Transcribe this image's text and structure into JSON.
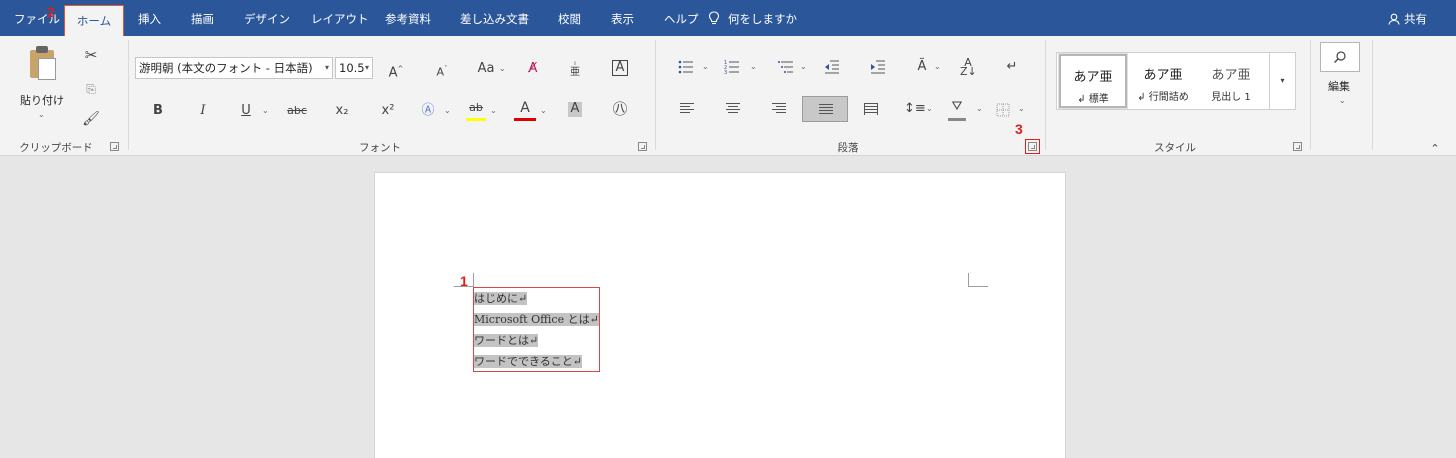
{
  "tabs": {
    "file": "ファイル",
    "home": "ホーム",
    "insert": "挿入",
    "draw": "描画",
    "design": "デザイン",
    "layout": "レイアウト",
    "references": "参考資料",
    "mailings": "差し込み文書",
    "review": "校閲",
    "view": "表示",
    "help": "ヘルプ"
  },
  "tellme": {
    "icon": "lightbulb-icon",
    "label": "何をしますか"
  },
  "share": {
    "icon": "person-icon",
    "label": "共有"
  },
  "markers": {
    "m1": "1",
    "m2": "2",
    "m3": "3"
  },
  "ribbon": {
    "clipboard": {
      "paste_label": "貼り付け",
      "group_label": "クリップボード"
    },
    "font": {
      "font_name": "游明朝 (本文のフォント - 日本語)",
      "font_size": "10.5",
      "group_label": "フォント",
      "bold": "B",
      "italic": "I",
      "underline": "U",
      "strike": "abc",
      "subscript": "x₂",
      "superscript": "x²",
      "case": "Aa",
      "grow": "A",
      "shrink": "A",
      "font_color": "A",
      "highlight": "ab",
      "char_shading": "A",
      "char_border": "A",
      "phonetic": "亜",
      "enclose": "字",
      "highlight_color": "#ffff00",
      "font_color_value": "#e00000"
    },
    "paragraph": {
      "group_label": "段落"
    },
    "styles": {
      "group_label": "スタイル",
      "items": [
        {
          "sample": "あア亜",
          "name": "↲ 標準"
        },
        {
          "sample": "あア亜",
          "name": "↲ 行間詰め"
        },
        {
          "sample": "あア亜",
          "name": "見出し 1"
        }
      ]
    },
    "editing": {
      "label": "編集"
    }
  },
  "document": {
    "lines": [
      "はじめに↵",
      "Microsoft Office とは↵",
      "ワードとは↵",
      "ワードでできること↵"
    ]
  },
  "colors": {
    "accent": "#2b579a",
    "annotation": "#e01e1e"
  }
}
